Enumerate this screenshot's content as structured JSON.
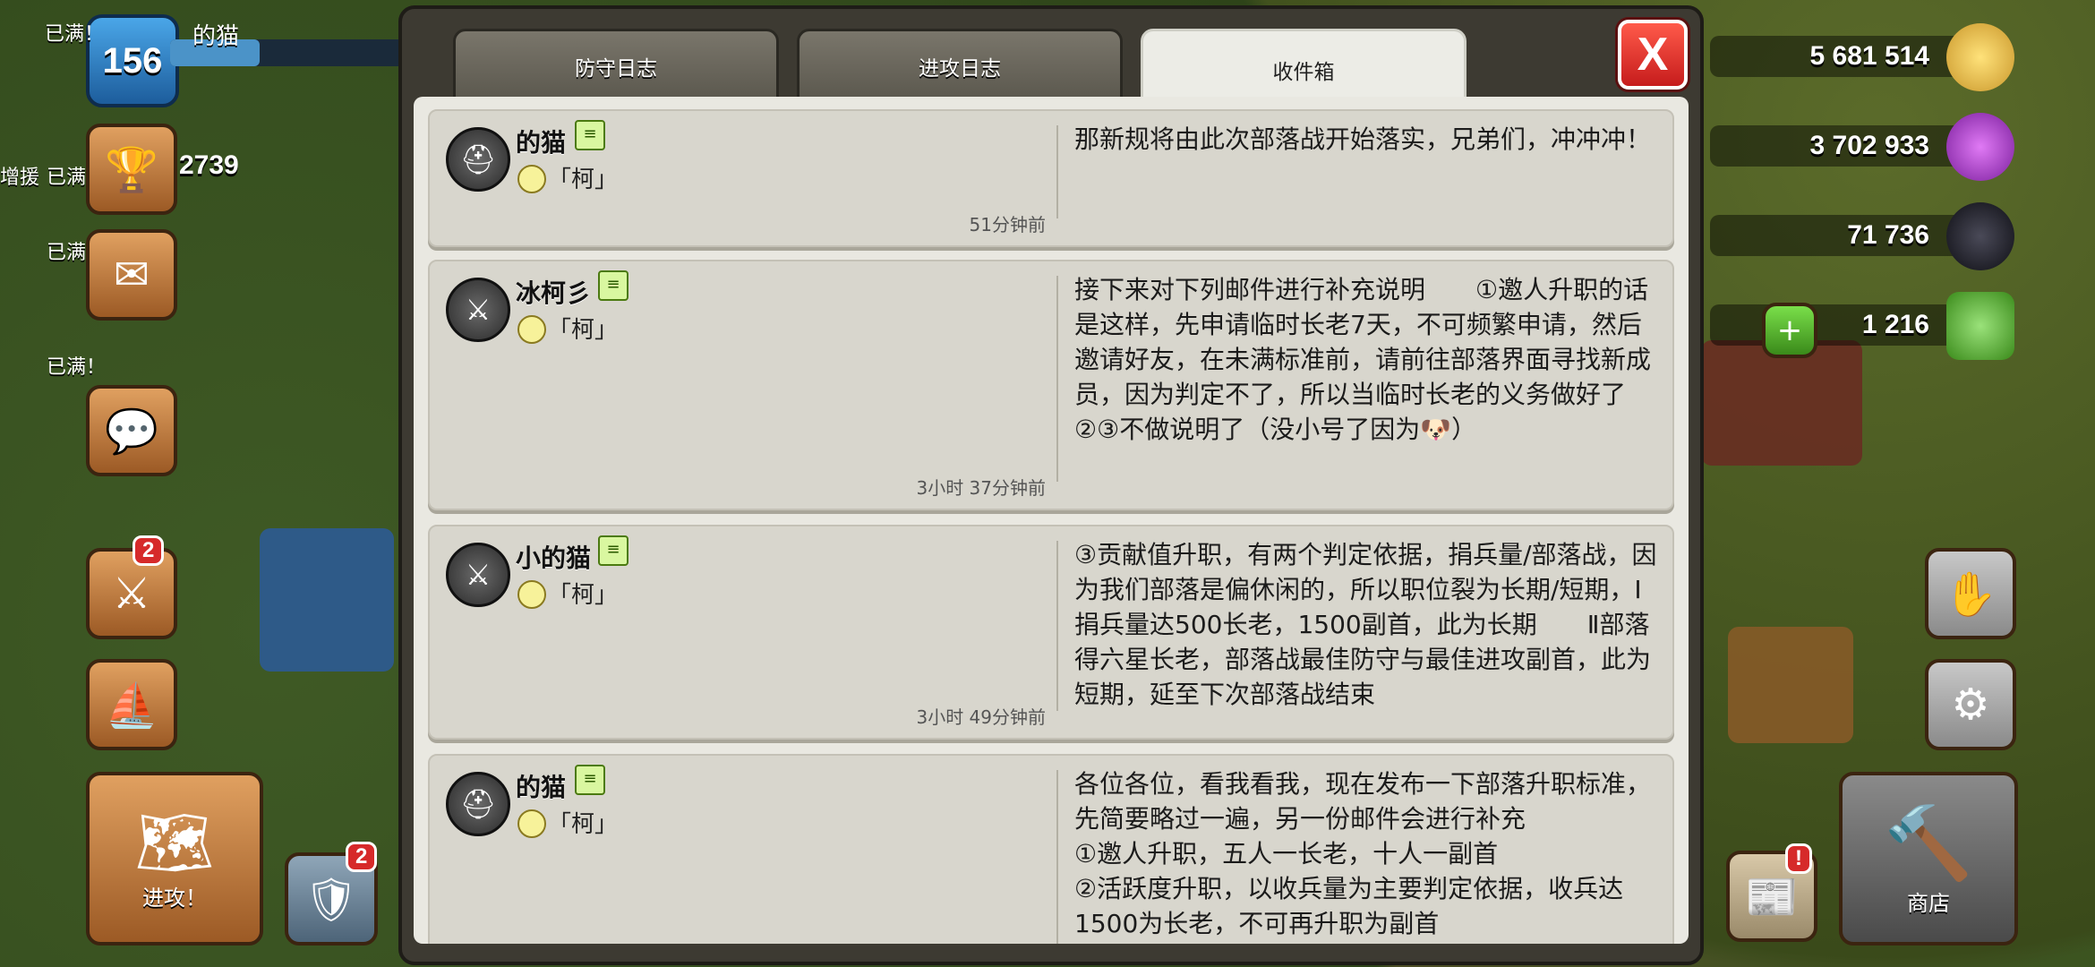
{
  "player": {
    "level": "156",
    "name": "的猫",
    "trophies": "2739"
  },
  "left_hud": {
    "side_labels": [
      "已满！",
      "增援",
      "已满",
      "已满",
      "已满！"
    ],
    "attack_badge": "2",
    "heal_badge": "2",
    "attack_button_label": "进攻！"
  },
  "resources": {
    "gold": "5 681 514",
    "elixir": "3 702 933",
    "dark_elixir": "71 736",
    "gems": "1 216"
  },
  "right_hud": {
    "shop_label": "商店",
    "notice_badge": "!"
  },
  "panel": {
    "tabs": [
      {
        "label": "防守日志",
        "active": false
      },
      {
        "label": "进攻日志",
        "active": false
      },
      {
        "label": "收件箱",
        "active": true
      }
    ],
    "close_label": "X"
  },
  "messages": [
    {
      "sender": "的猫",
      "clan": "「柯」",
      "time": "51分钟前",
      "body": "那新规将由此次部落战开始落实，兄弟们，冲冲冲！"
    },
    {
      "sender": "冰柯彡",
      "clan": "「柯」",
      "time": "3小时 37分钟前",
      "body": "接下来对下列邮件进行补充说明　　①邀人升职的话是这样，先申请临时长老7天，不可频繁申请，然后邀请好友，在未满标准前，请前往部落界面寻找新成员，因为判定不了，所以当临时长老的义务做好了　②③不做说明了（没小号了因为🐶）"
    },
    {
      "sender": "小的猫",
      "clan": "「柯」",
      "time": "3小时 49分钟前",
      "body": "③贡献值升职，有两个判定依据，捐兵量/部落战，因为我们部落是偏休闲的，所以职位裂为长期/短期，Ⅰ捐兵量达500长老，1500副首，此为长期　　Ⅱ部落得六星长老，部落战最佳防守与最佳进攻副首，此为短期，延至下次部落战结束"
    },
    {
      "sender": "的猫",
      "clan": "「柯」",
      "time": "",
      "body": "各位各位，看我看我，现在发布一下部落升职标准，先简要略过一遍，另一份邮件会进行补充\n①邀人升职，五人一长老，十人一副首\n②活跃度升职，以收兵量为主要判定依据，收兵达1500为长老，不可再升职为副首"
    }
  ]
}
